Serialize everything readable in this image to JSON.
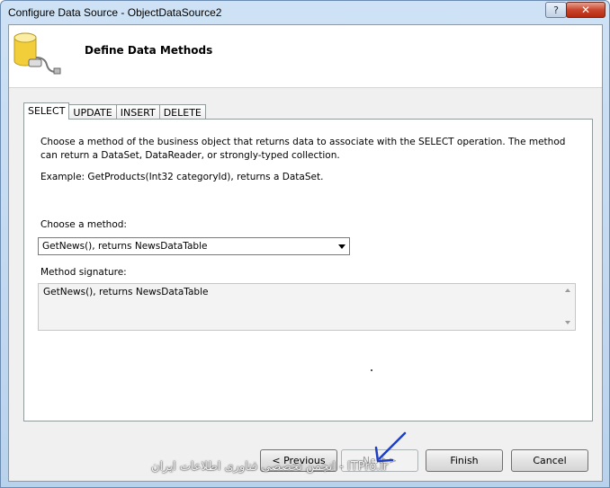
{
  "window": {
    "title": "Configure Data Source - ObjectDataSource2"
  },
  "header": {
    "title": "Define Data Methods",
    "icon": "database-plug-icon"
  },
  "tabs": [
    {
      "label": "SELECT",
      "active": true
    },
    {
      "label": "UPDATE",
      "active": false
    },
    {
      "label": "INSERT",
      "active": false
    },
    {
      "label": "DELETE",
      "active": false
    }
  ],
  "panel": {
    "description": "Choose a method of the business object that returns data to associate with the SELECT operation. The method can return a DataSet, DataReader, or strongly-typed collection.",
    "example": "Example: GetProducts(Int32 categoryId), returns a DataSet.",
    "choose_label": "Choose a method:",
    "method_selected": "GetNews(), returns NewsDataTable",
    "signature_label": "Method signature:",
    "signature_value": "GetNews(), returns NewsDataTable"
  },
  "buttons": {
    "previous": "< Previous",
    "next": "Next >",
    "finish": "Finish",
    "cancel": "Cancel"
  },
  "watermark": "ITPro.ir - انجمن تخصصی فناوری اطلاعات ایران",
  "colors": {
    "accent": "#1f3fbf",
    "title_bg": "#c8dcf2",
    "close": "#c9452c"
  }
}
